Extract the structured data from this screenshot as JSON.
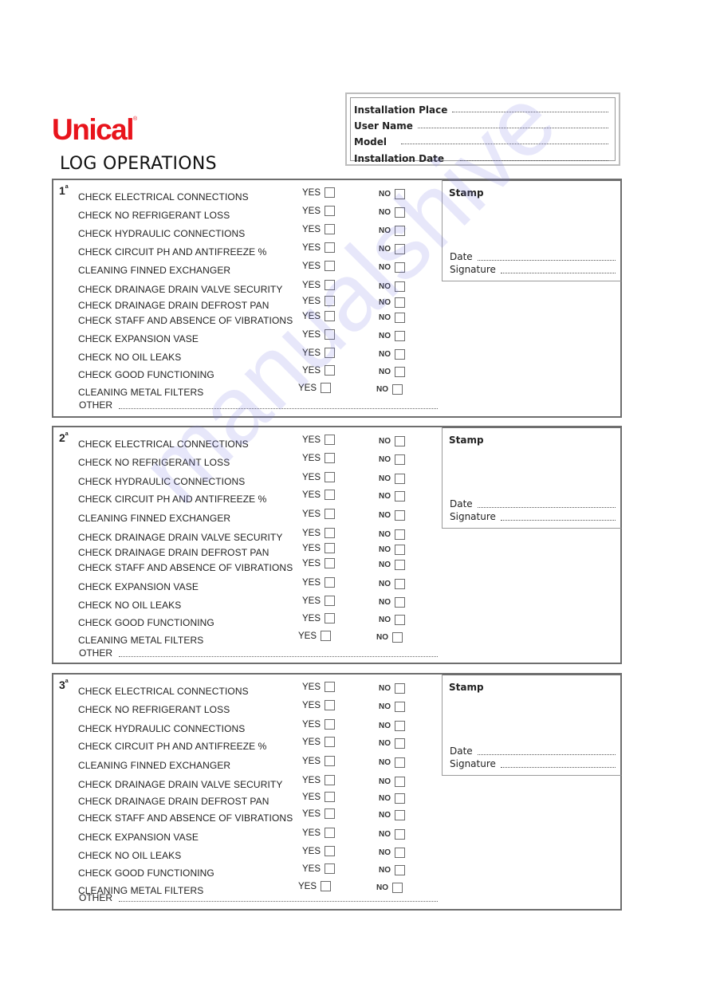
{
  "header": {
    "brand": "Unical",
    "brand_mark": "®",
    "brand_color": "#e8141c",
    "title": "LOG OPERATIONS"
  },
  "info": {
    "fields": [
      {
        "label": "Installation Place",
        "value": ""
      },
      {
        "label": "User Name",
        "value": ""
      },
      {
        "label": "Model",
        "value": ""
      },
      {
        "label": "Installation Date",
        "value": ""
      }
    ]
  },
  "labels": {
    "yes": "YES",
    "no": "NO",
    "other": "OTHER",
    "stamp": "Stamp",
    "date": "Date",
    "signature": "Signature"
  },
  "sections": [
    {
      "number": "1",
      "ordinal": "a"
    },
    {
      "number": "2",
      "ordinal": "a"
    },
    {
      "number": "3",
      "ordinal": "a"
    }
  ],
  "checks": [
    "CHECK ELECTRICAL CONNECTIONS",
    "CHECK NO REFRIGERANT LOSS",
    "CHECK HYDRAULIC CONNECTIONS",
    "CHECK CIRCUIT PH AND  ANTIFREEZE %",
    "CLEANING FINNED EXCHANGER",
    "CHECK DRAINAGE DRAIN VALVE SECURITY",
    "CHECK DRAINAGE DRAIN DEFROST PAN",
    "CHECK STAFF AND ABSENCE OF VIBRATIONS",
    "CHECK EXPANSION VASE",
    "CHECK NO OIL LEAKS",
    "CHECK GOOD FUNCTIONING",
    "CLEANING METAL FILTERS"
  ],
  "watermark": "manualshive"
}
